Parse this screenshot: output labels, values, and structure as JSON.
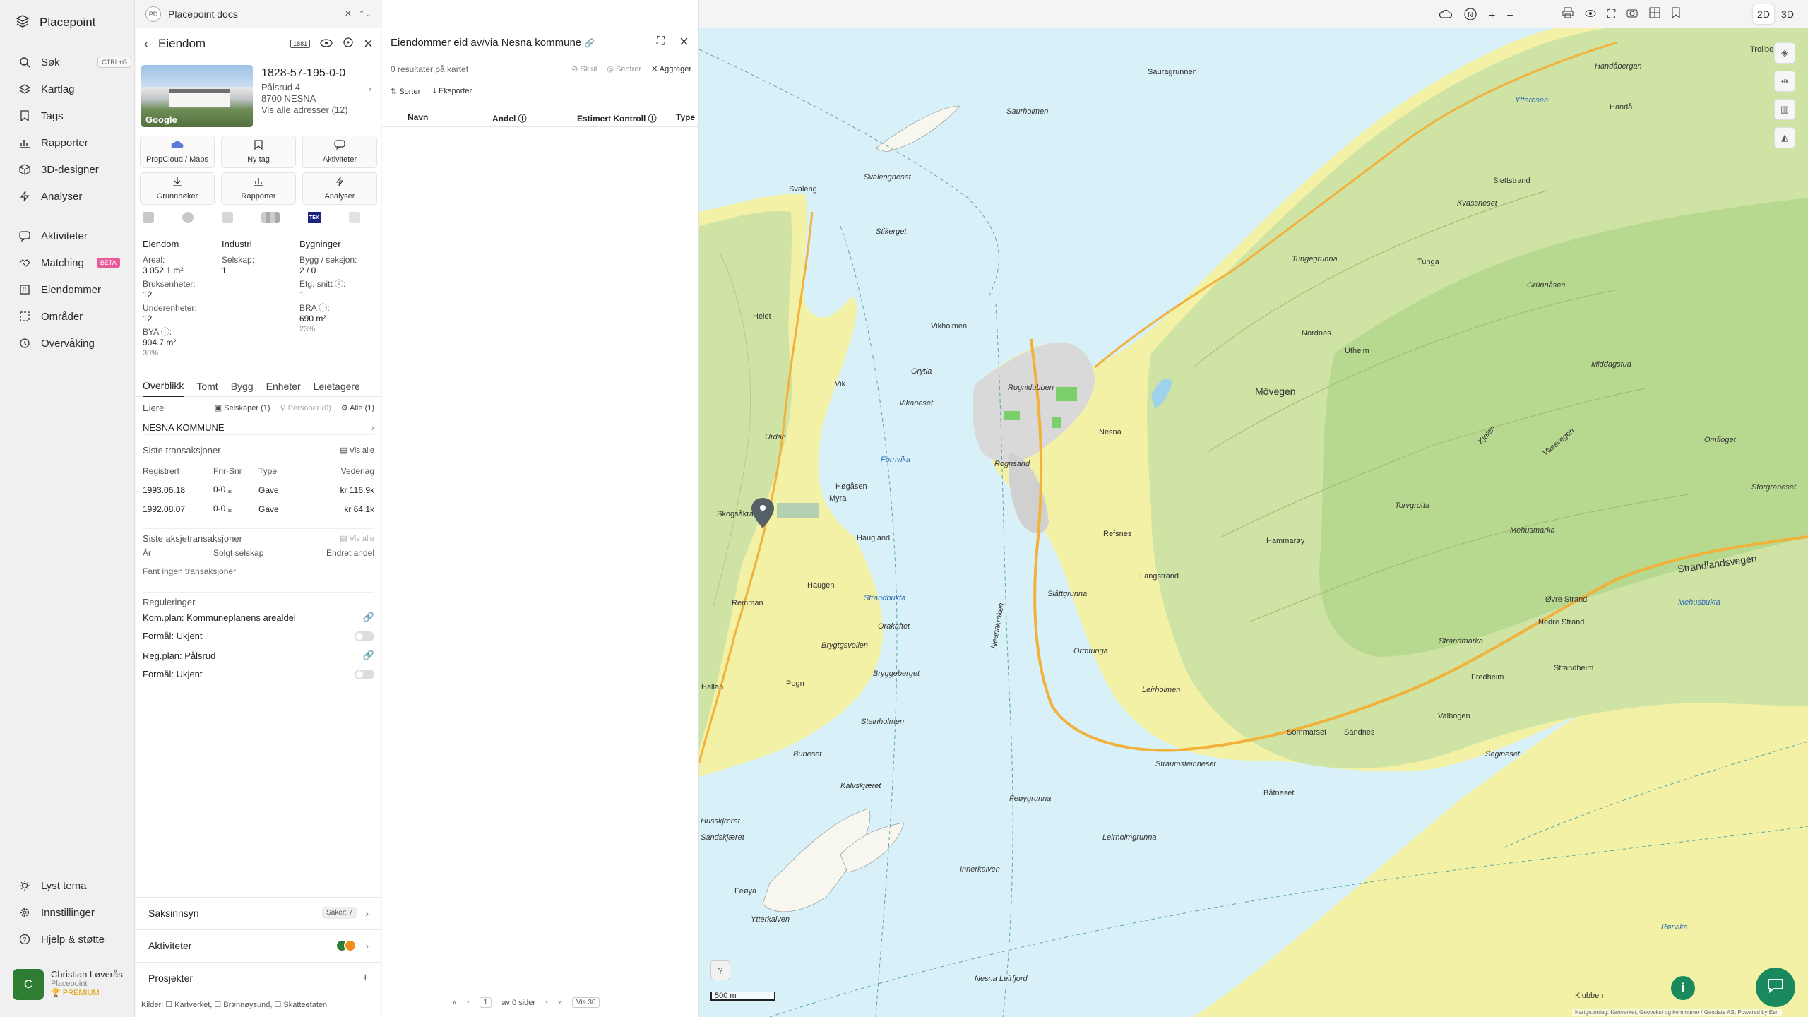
{
  "brand": {
    "name": "Placepoint"
  },
  "nav": {
    "items": [
      {
        "label": "Søk",
        "shortcut": "CTRL+G",
        "icon": "search-icon"
      },
      {
        "label": "Kartlag",
        "icon": "layers-icon"
      },
      {
        "label": "Tags",
        "icon": "bookmark-icon"
      },
      {
        "label": "Rapporter",
        "icon": "bar-chart-icon"
      },
      {
        "label": "3D-designer",
        "icon": "cube-icon"
      },
      {
        "label": "Analyser",
        "icon": "bolt-icon"
      },
      {
        "label": "Aktiviteter",
        "icon": "chat-icon"
      },
      {
        "label": "Matching",
        "badge": "BETA",
        "icon": "handshake-icon"
      },
      {
        "label": "Eiendommer",
        "icon": "buildings-icon"
      },
      {
        "label": "Områder",
        "icon": "area-icon"
      },
      {
        "label": "Overvåking",
        "icon": "eye-icon"
      }
    ],
    "bottom": [
      {
        "label": "Lyst tema",
        "icon": "sun-icon"
      },
      {
        "label": "Innstillinger",
        "icon": "gear-icon"
      },
      {
        "label": "Hjelp & støtte",
        "icon": "help-icon"
      }
    ],
    "user": {
      "initial": "C",
      "name": "Christian Løverås",
      "org": "Placepoint",
      "plan": "PREMIUM"
    }
  },
  "docbar": {
    "badge": "PD",
    "title": "Placepoint docs"
  },
  "property": {
    "title": "Eiendom",
    "id": "1828-57-195-0-0",
    "address": "Pålsrud 4",
    "postal": "8700 NESNA",
    "all_addresses": "Vis alle adresser (12)",
    "photo_credit": "Google",
    "actions": [
      {
        "label": "PropCloud / Maps",
        "icon": "cloud-icon"
      },
      {
        "label": "Ny tag",
        "icon": "bookmark-icon"
      },
      {
        "label": "Aktiviteter",
        "icon": "chat-icon"
      },
      {
        "label": "Grunnbøker",
        "icon": "download-icon"
      },
      {
        "label": "Rapporter",
        "icon": "bar-chart-icon"
      },
      {
        "label": "Analyser",
        "icon": "bolt-icon"
      }
    ],
    "tek_label": "TEK",
    "facts": {
      "col1": {
        "head": "Eiendom",
        "areal_l": "Areal:",
        "areal_v": "3 052.1 m²",
        "bruks_l": "Bruksenheter:",
        "bruks_v": "12",
        "under_l": "Underenheter:",
        "under_v": "12",
        "bya_l": "BYA ⓘ:",
        "bya_v": "904.7 m²",
        "bya_p": "30%"
      },
      "col2": {
        "head": "Industri",
        "selskap_l": "Selskap:",
        "selskap_v": "1"
      },
      "col3": {
        "head": "Bygninger",
        "bygg_l": "Bygg / seksjon:",
        "bygg_v": "2 / 0",
        "etg_l": "Etg. snitt ⓘ:",
        "etg_v": "1",
        "bra_l": "BRA ⓘ:",
        "bra_v": "690 m²",
        "bra_p": "23%"
      }
    },
    "tabs": [
      "Overblikk",
      "Tomt",
      "Bygg",
      "Enheter",
      "Leietagere"
    ],
    "owners": {
      "label": "Eiere",
      "companies": "Selskaper (1)",
      "persons": "Personer (0)",
      "all": "Alle (1)",
      "name": "NESNA KOMMUNE"
    },
    "transactions": {
      "label": "Siste transaksjoner",
      "show_all": "Vis alle",
      "headers": [
        "Registrert",
        "Fnr-Snr",
        "Type",
        "Vederlag"
      ],
      "rows": [
        {
          "date": "1993.06.18",
          "fnr": "0-0 ⤓",
          "type": "Gave",
          "amount": "kr 116.9k"
        },
        {
          "date": "1992.08.07",
          "fnr": "0-0 ⤓",
          "type": "Gave",
          "amount": "kr 64.1k"
        }
      ]
    },
    "stock_tx": {
      "label": "Siste aksjetransaksjoner",
      "show_all": "Vis alle",
      "headers": [
        "År",
        "Solgt selskap",
        "Endret andel"
      ],
      "empty": "Fant ingen transaksjoner"
    },
    "regulations": {
      "label": "Reguleringer",
      "rows": [
        {
          "text": "Kom.plan: Kommuneplanens arealdel"
        },
        {
          "text": "Formål: Ukjent"
        },
        {
          "text": "Reg.plan: Pålsrud"
        },
        {
          "text": "Formål: Ukjent"
        }
      ]
    },
    "bottom": {
      "saksinnsyn": "Saksinnsyn",
      "saker": "Saker: 7",
      "aktiviteter": "Aktiviteter",
      "prosjekter": "Prosjekter"
    },
    "sources": "Kilder: ☐ Kartverket, ☐ Brønnøysund, ☐ Skatteetaten"
  },
  "list": {
    "title": "Eiendommer eid av/via Nesna kommune",
    "results": "0 resultater på kartet",
    "hide": "Skjul",
    "center": "Sentrer",
    "aggregate": "Aggreger",
    "sort": "Sorter",
    "export": "Eksporter",
    "columns": [
      "Navn",
      "Andel ⓘ",
      "Estimert Kontroll ⓘ",
      "Type"
    ],
    "pager": {
      "page": "1",
      "of": "av 0 sider",
      "per": "Vis 30"
    }
  },
  "map": {
    "mode_2d": "2D",
    "mode_3d": "3D",
    "scale": "500 m",
    "places": [
      "Sauragrunnen",
      "Saurholmen",
      "Svaleng",
      "Svalengneset",
      "Stikerget",
      "Heiet",
      "Vikholmen",
      "Grytia",
      "Vikaneset",
      "Rognklubben",
      "Rognsand",
      "Nesna",
      "Mövegen",
      "Nordnes",
      "Utheim",
      "Tungegrunna",
      "Tunga",
      "Kvassneset",
      "Siettstrand",
      "Handå",
      "Handåbergan",
      "Trollbergan",
      "Ytterosen",
      "Grünnåsen",
      "Middagstua",
      "Kjelen",
      "Vassvegen",
      "Omfloget",
      "Refsnes",
      "Langstrand",
      "Hammarøy",
      "Torvgrotta",
      "Mehusmarka",
      "Strandlandsvegen",
      "Mehusbukta",
      "Nedre Strand",
      "Øvre Strand",
      "Strandmarka",
      "Strandheim",
      "Fredheim",
      "Valbogen",
      "Sandnes",
      "Sommarset",
      "Segineset",
      "Båtneset",
      "Straumsteinneset",
      "Leirholmen",
      "Ormtunga",
      "Slåttgrunna",
      "Neanakroken",
      "Feøygrunna",
      "Leirholmgrunna",
      "Innerkalven",
      "Ytterkalven",
      "Feøya",
      "Kalvskjæret",
      "Buneset",
      "Steinholmen",
      "Bryggeberget",
      "Brygtgsvollen",
      "Haugen",
      "Haugland",
      "Høgåsen",
      "Myra",
      "Urdan",
      "Vik",
      "Skogsåkra",
      "Remman",
      "Orakaftet",
      "Strandbukta",
      "Hallan",
      "Pogn",
      "Husskjæret",
      "Sandskjæret",
      "Rørvika",
      "Klubben",
      "Storgraneset",
      "Nesna Leirfjord",
      "Fornvika"
    ],
    "attribution": "Kartgrunnlag: Kartverket, Geovekst og kommuner / Geodata AS, Powered by Esri"
  }
}
